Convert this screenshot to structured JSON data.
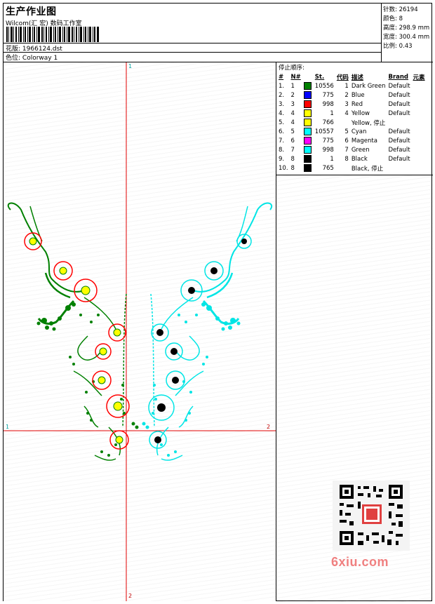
{
  "header": {
    "title": "生产作业图",
    "company": "Wilcom(汇 宏) 数码工作室",
    "design_label": "花版:",
    "design_name": "1966124.dst",
    "colorway_label": "色位:",
    "colorway_name": "Colorway 1"
  },
  "stats": [
    {
      "label": "针数:",
      "value": "26194"
    },
    {
      "label": "颜色:",
      "value": "8"
    },
    {
      "label": "高度:",
      "value": "298.9 mm"
    },
    {
      "label": "宽度:",
      "value": "300.4 mm"
    },
    {
      "label": "比例:",
      "value": "0.43"
    }
  ],
  "stop_sequence": {
    "title": "停止顺序:",
    "headers": [
      "#",
      "N#",
      "St.",
      "代码",
      "描述",
      "Brand",
      "元素"
    ],
    "rows": [
      {
        "n": "1.",
        "nn": "1",
        "color": "#008000",
        "st": "10556",
        "code": "1",
        "desc": "Dark Green",
        "brand": "Default"
      },
      {
        "n": "2.",
        "nn": "2",
        "color": "#0000ff",
        "st": "775",
        "code": "2",
        "desc": "Blue",
        "brand": "Default"
      },
      {
        "n": "3.",
        "nn": "3",
        "color": "#ff0000",
        "st": "998",
        "code": "3",
        "desc": "Red",
        "brand": "Default"
      },
      {
        "n": "4.",
        "nn": "4",
        "color": "#ffff00",
        "st": "1",
        "code": "4",
        "desc": "Yellow",
        "brand": "Default"
      },
      {
        "n": "5.",
        "nn": "4",
        "color": "#ffff00",
        "st": "766",
        "code": "",
        "desc": "Yellow, 停止",
        "brand": ""
      },
      {
        "n": "6.",
        "nn": "5",
        "color": "#00ffff",
        "st": "10557",
        "code": "5",
        "desc": "Cyan",
        "brand": "Default"
      },
      {
        "n": "7.",
        "nn": "6",
        "color": "#ff00ff",
        "st": "775",
        "code": "6",
        "desc": "Magenta",
        "brand": "Default"
      },
      {
        "n": "8.",
        "nn": "7",
        "color": "#00ffff",
        "st": "998",
        "code": "7",
        "desc": "Green",
        "brand": "Default"
      },
      {
        "n": "9.",
        "nn": "8",
        "color": "#000000",
        "st": "1",
        "code": "8",
        "desc": "Black",
        "brand": "Default"
      },
      {
        "n": "10.",
        "nn": "8",
        "color": "#000000",
        "st": "765",
        "code": "",
        "desc": "Black, 停止",
        "brand": ""
      }
    ]
  },
  "axes": {
    "top": "1",
    "bottom": "2",
    "left": "1",
    "right": "2"
  },
  "watermark": "6xiu.com",
  "colors": {
    "green": "#008000",
    "cyan": "#00e5e5",
    "red": "#ff0000",
    "yellow": "#ffff00",
    "axis": "#e00000"
  }
}
